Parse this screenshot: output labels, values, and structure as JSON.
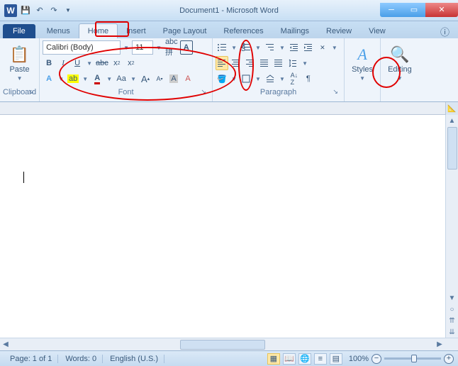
{
  "title": "Document1 - Microsoft Word",
  "tabs": {
    "file": "File",
    "menus": "Menus",
    "home": "Home",
    "insert": "Insert",
    "pagelayout": "Page Layout",
    "references": "References",
    "mailings": "Mailings",
    "review": "Review",
    "view": "View"
  },
  "clipboard": {
    "paste": "Paste",
    "label": "Clipboard"
  },
  "font": {
    "name": "Calibri (Body)",
    "size": "11",
    "label": "Font"
  },
  "paragraph": {
    "label": "Paragraph"
  },
  "styles": {
    "label": "Styles",
    "btn": "Styles"
  },
  "editing": {
    "label": "Editing",
    "btn": "Editing"
  },
  "status": {
    "page": "Page: 1 of 1",
    "words": "Words: 0",
    "lang": "English (U.S.)",
    "zoom": "100%"
  }
}
